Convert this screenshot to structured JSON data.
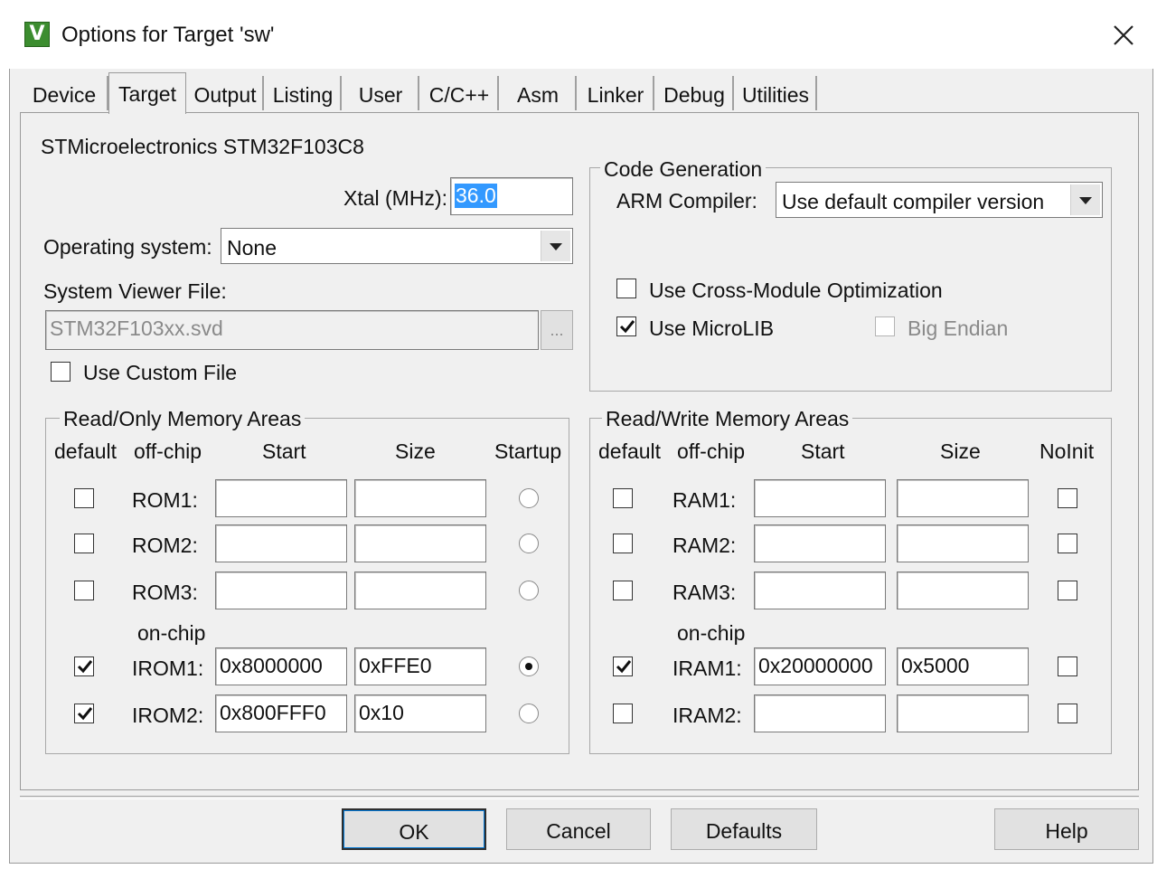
{
  "window": {
    "title": "Options for Target 'sw'"
  },
  "tabs": [
    "Device",
    "Target",
    "Output",
    "Listing",
    "User",
    "C/C++",
    "Asm",
    "Linker",
    "Debug",
    "Utilities"
  ],
  "active_tab": "Target",
  "device_name": "STMicroelectronics STM32F103C8",
  "xtal": {
    "label": "Xtal (MHz):",
    "value": "36.0"
  },
  "os": {
    "label": "Operating system:",
    "value": "None"
  },
  "svf": {
    "label": "System Viewer File:",
    "value": "STM32F103xx.svd",
    "browse_label": "...",
    "custom_label": "Use Custom File",
    "custom_checked": false
  },
  "codegen": {
    "legend": "Code Generation",
    "compiler_label": "ARM Compiler:",
    "compiler_value": "Use default compiler version",
    "cross_module_label": "Use Cross-Module Optimization",
    "cross_module_checked": false,
    "microlib_label": "Use MicroLIB",
    "microlib_checked": true,
    "big_endian_label": "Big Endian",
    "big_endian_checked": false
  },
  "ro": {
    "legend": "Read/Only Memory Areas",
    "headers": {
      "default": "default",
      "offchip": "off-chip",
      "start": "Start",
      "size": "Size",
      "startup": "Startup"
    },
    "onchip_label": "on-chip",
    "rows": [
      {
        "name": "ROM1:",
        "default": false,
        "start": "",
        "size": "",
        "startup": false
      },
      {
        "name": "ROM2:",
        "default": false,
        "start": "",
        "size": "",
        "startup": false
      },
      {
        "name": "ROM3:",
        "default": false,
        "start": "",
        "size": "",
        "startup": false
      },
      {
        "name": "IROM1:",
        "default": true,
        "start": "0x8000000",
        "size": "0xFFE0",
        "startup": true
      },
      {
        "name": "IROM2:",
        "default": true,
        "start": "0x800FFF0",
        "size": "0x10",
        "startup": false
      }
    ]
  },
  "rw": {
    "legend": "Read/Write Memory Areas",
    "headers": {
      "default": "default",
      "offchip": "off-chip",
      "start": "Start",
      "size": "Size",
      "noinit": "NoInit"
    },
    "onchip_label": "on-chip",
    "rows": [
      {
        "name": "RAM1:",
        "default": false,
        "start": "",
        "size": "",
        "noinit": false
      },
      {
        "name": "RAM2:",
        "default": false,
        "start": "",
        "size": "",
        "noinit": false
      },
      {
        "name": "RAM3:",
        "default": false,
        "start": "",
        "size": "",
        "noinit": false
      },
      {
        "name": "IRAM1:",
        "default": true,
        "start": "0x20000000",
        "size": "0x5000",
        "noinit": false
      },
      {
        "name": "IRAM2:",
        "default": false,
        "start": "",
        "size": "",
        "noinit": false
      }
    ]
  },
  "buttons": {
    "ok": "OK",
    "cancel": "Cancel",
    "defaults": "Defaults",
    "help": "Help"
  },
  "colors": {
    "selection": "#3399ff",
    "app_icon": "#3c8d2f"
  }
}
